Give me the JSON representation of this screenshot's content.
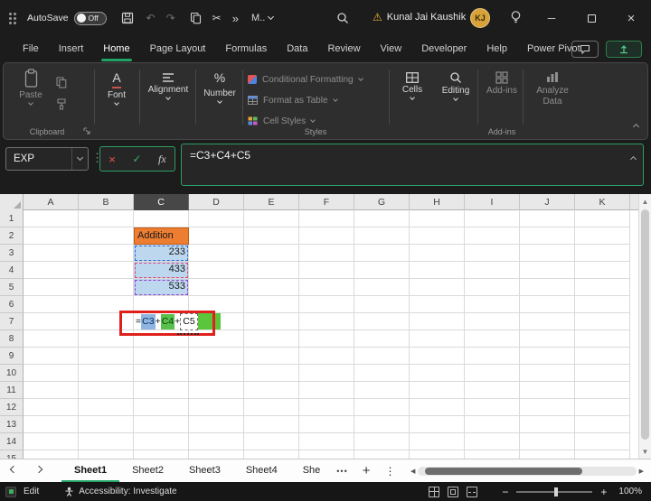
{
  "colors": {
    "accent_green": "#21a366",
    "orange_fill": "#ED7D31",
    "blue_fill": "#BDD7EE",
    "green_fill": "#5BC53B",
    "annotation_red": "#E0201C",
    "avatar_gold": "#D8A23A"
  },
  "titlebar": {
    "autosave_label": "AutoSave",
    "autosave_state": "Off",
    "more_label": "M..",
    "user_name": "Kunal Jai Kaushik",
    "avatar_initials": "KJ"
  },
  "icons": {
    "undo": "↶",
    "redo": "↷",
    "scissors": "✂",
    "more_commands": "»",
    "warning": "⚠",
    "minimize": "─",
    "close": "×",
    "kebab": "⋮",
    "up_triangle": "▲",
    "down_triangle": "▼",
    "left_triangle": "◀",
    "right_triangle": "▶",
    "font_letter": "A",
    "percent": "%"
  },
  "ribbon_tabs": [
    "File",
    "Insert",
    "Home",
    "Page Layout",
    "Formulas",
    "Data",
    "Review",
    "View",
    "Developer",
    "Help",
    "Power Pivot"
  ],
  "ribbon": {
    "paste_label": "Paste",
    "clipboard_group_label": "Clipboard",
    "font_label": "Font",
    "alignment_label": "Alignment",
    "number_label": "Number",
    "conditional_formatting_label": "Conditional Formatting",
    "format_as_table_label": "Format as Table",
    "cell_styles_label": "Cell Styles",
    "styles_group_label": "Styles",
    "cells_label": "Cells",
    "editing_label": "Editing",
    "addins_label": "Add-ins",
    "addins_group_label": "Add-ins",
    "analyze_data_label": "Analyze Data"
  },
  "formula_bar": {
    "name_box_value": "EXP",
    "cancel_glyph": "×",
    "enter_glyph": "✓",
    "fx_label": "fx",
    "formula": "=C3+C4+C5"
  },
  "grid": {
    "columns": [
      "A",
      "B",
      "C",
      "D",
      "E",
      "F",
      "G",
      "H",
      "I",
      "J",
      "K"
    ],
    "row_count": 15,
    "selected_column": "C",
    "cells": [
      {
        "col": "C",
        "row": 2,
        "text": "Addition",
        "style": "orange",
        "align": "left"
      },
      {
        "col": "C",
        "row": 3,
        "text": "233",
        "style": "blue ref-blue",
        "align": "right"
      },
      {
        "col": "C",
        "row": 4,
        "text": "433",
        "style": "blue ref-pink",
        "align": "right"
      },
      {
        "col": "C",
        "row": 5,
        "text": "533",
        "style": "blue ref-purple",
        "align": "right"
      }
    ],
    "formula_cell": {
      "col": "C",
      "row": 7,
      "parts": [
        {
          "text": "=",
          "style": "plain"
        },
        {
          "text": "C3",
          "style": "hl-blue"
        },
        {
          "text": "+",
          "style": "plain"
        },
        {
          "text": "C4",
          "style": "hl-green"
        },
        {
          "text": "+",
          "style": "plain"
        },
        {
          "text": "C5",
          "style": "hl-white"
        }
      ]
    },
    "green_fill_cell": {
      "col": "D",
      "row": 7
    }
  },
  "sheet_bar": {
    "tabs": [
      "Sheet1",
      "Sheet2",
      "Sheet3",
      "Sheet4",
      "She"
    ],
    "active_tab": "Sheet1",
    "overflow_label": "•••",
    "add_label": "+"
  },
  "status_bar": {
    "mode": "Edit",
    "accessibility": "Accessibility: Investigate",
    "zoom": "100%"
  }
}
